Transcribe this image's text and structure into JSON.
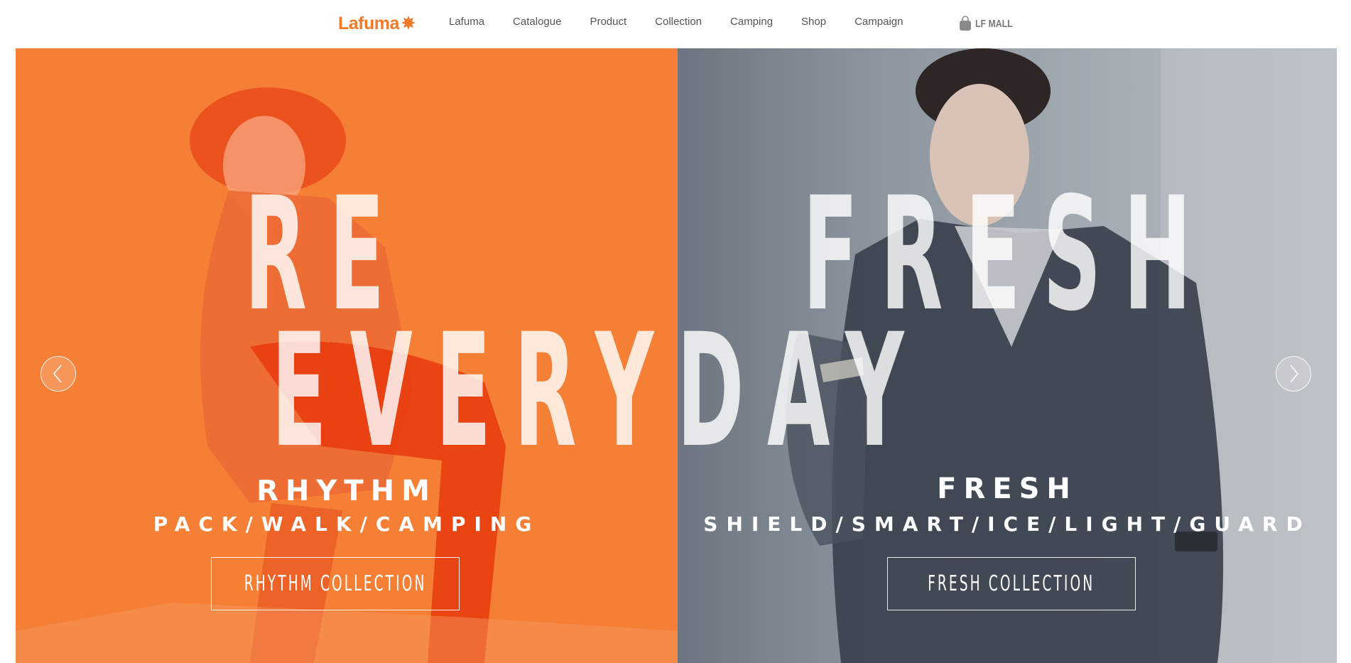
{
  "brand": {
    "name": "Lafuma",
    "accent": "#f07a2a"
  },
  "nav": {
    "items": [
      "Lafuma",
      "Catalogue",
      "Product",
      "Collection",
      "Camping",
      "Shop",
      "Campaign"
    ]
  },
  "mall": {
    "label": "LF MALL",
    "icon": "shopping-bag-icon"
  },
  "hero": {
    "headline_top_left": "RE",
    "headline_top_right": "FRESH",
    "headline_main": "EVERYDAY",
    "left": {
      "title": "RHYTHM",
      "subtitle": "PACK/WALK/CAMPING",
      "button": "RHYTHM COLLECTION",
      "bg_color": "#f58035"
    },
    "right": {
      "title": "FRESH",
      "subtitle": "SHIELD/SMART/ICE/LIGHT/GUARD",
      "button": "FRESH COLLECTION",
      "bg_color": "#8c959e"
    },
    "prev_icon": "chevron-left-icon",
    "next_icon": "chevron-right-icon"
  }
}
